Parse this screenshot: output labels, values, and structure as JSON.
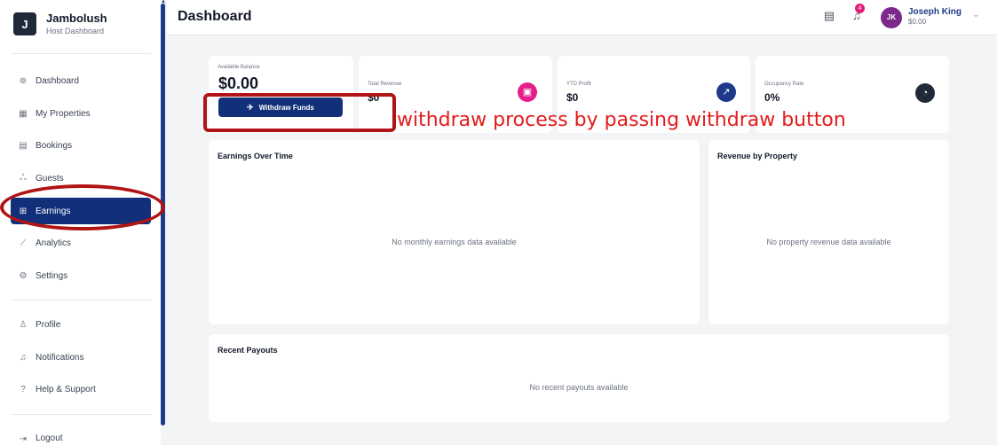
{
  "brand": {
    "name": "Jambolush",
    "subtitle": "Host Dashboard",
    "logo_letter": "J"
  },
  "sidebar": {
    "items": [
      {
        "label": "Dashboard",
        "icon": "dashboard-icon",
        "glyph": "⊚"
      },
      {
        "label": "My Properties",
        "icon": "building-icon",
        "glyph": "▦"
      },
      {
        "label": "Bookings",
        "icon": "calendar-icon",
        "glyph": "▤"
      },
      {
        "label": "Guests",
        "icon": "users-icon",
        "glyph": "ஃ"
      },
      {
        "label": "Earnings",
        "icon": "wallet-icon",
        "glyph": "⊞",
        "active": true
      },
      {
        "label": "Analytics",
        "icon": "chart-line-icon",
        "glyph": "⟋"
      },
      {
        "label": "Settings",
        "icon": "gear-icon",
        "glyph": "⚙"
      }
    ],
    "secondary": [
      {
        "label": "Profile",
        "icon": "user-icon",
        "glyph": "♙"
      },
      {
        "label": "Notifications",
        "icon": "bell-icon",
        "glyph": "♫"
      },
      {
        "label": "Help & Support",
        "icon": "help-icon",
        "glyph": "?"
      }
    ],
    "logout": {
      "label": "Logout",
      "icon": "logout-icon",
      "glyph": "⇥"
    }
  },
  "header": {
    "title": "Dashboard",
    "notification_count": "4",
    "user": {
      "initials": "JK",
      "name": "Joseph King",
      "balance": "$0.00"
    }
  },
  "stats": {
    "balance": {
      "label": "Available Balance",
      "value": "$0.00",
      "button_label": "Withdraw Funds"
    },
    "revenue": {
      "label": "Total Revenue",
      "value": "$0",
      "icon": "cash-icon",
      "color": "#e61e8c"
    },
    "profit": {
      "label": "YTD Profit",
      "value": "$0",
      "icon": "trend-up-icon",
      "color": "#1e3a8a"
    },
    "occupancy": {
      "label": "Occupancy Rate",
      "value": "0%",
      "icon": "gauge-icon",
      "color": "#1f2937"
    }
  },
  "panels": {
    "earnings": {
      "title": "Earnings Over Time",
      "empty": "No monthly earnings data available"
    },
    "property": {
      "title": "Revenue by Property",
      "empty": "No property revenue data available"
    },
    "payouts": {
      "title": "Recent Payouts",
      "empty": "No recent payouts available"
    }
  },
  "annotation": {
    "text": "withdraw process by passing withdraw button",
    "color": "#e31b1b"
  }
}
